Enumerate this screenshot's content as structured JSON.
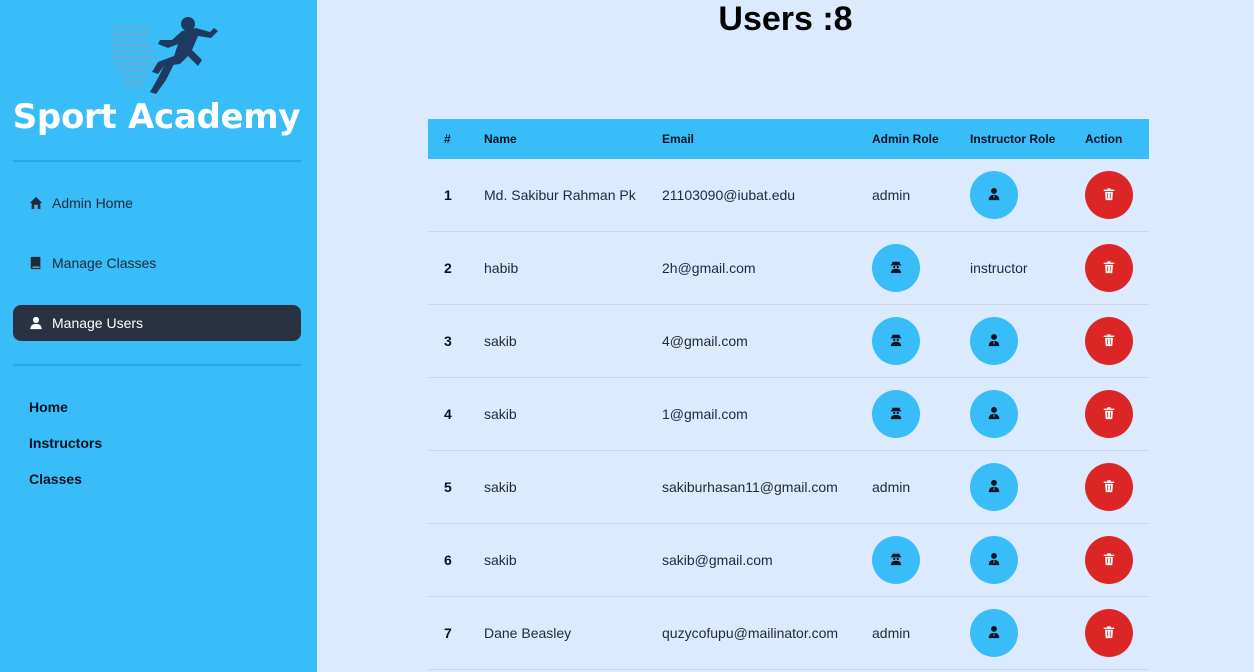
{
  "sidebar": {
    "brand": "Sport Academy",
    "menu": [
      {
        "label": "Admin Home",
        "icon": "home-icon"
      },
      {
        "label": "Manage Classes",
        "icon": "book-icon"
      },
      {
        "label": "Manage Users",
        "icon": "user-icon",
        "active": true
      }
    ],
    "links": [
      "Home",
      "Instructors",
      "Classes"
    ]
  },
  "main": {
    "title": "Users :8",
    "columns": [
      "#",
      "Name",
      "Email",
      "Admin Role",
      "Instructor Role",
      "Action"
    ],
    "rows": [
      {
        "num": "1",
        "name": "Md. Sakibur Rahman Pk",
        "email": "21103090@iubat.edu",
        "admin": "admin",
        "instructor": null
      },
      {
        "num": "2",
        "name": "habib",
        "email": "2h@gmail.com",
        "admin": null,
        "instructor": "instructor"
      },
      {
        "num": "3",
        "name": "sakib",
        "email": "4@gmail.com",
        "admin": null,
        "instructor": null
      },
      {
        "num": "4",
        "name": "sakib",
        "email": "1@gmail.com",
        "admin": null,
        "instructor": null
      },
      {
        "num": "5",
        "name": "sakib",
        "email": "sakiburhasan11@gmail.com",
        "admin": "admin",
        "instructor": null
      },
      {
        "num": "6",
        "name": "sakib",
        "email": "sakib@gmail.com",
        "admin": null,
        "instructor": null
      },
      {
        "num": "7",
        "name": "Dane Beasley",
        "email": "quzycofupu@mailinator.com",
        "admin": "admin",
        "instructor": null
      }
    ]
  },
  "colors": {
    "sidebar": "#38bdf8",
    "background": "#dbeafe",
    "active_menu": "#2a3140",
    "danger": "#dc2626"
  }
}
